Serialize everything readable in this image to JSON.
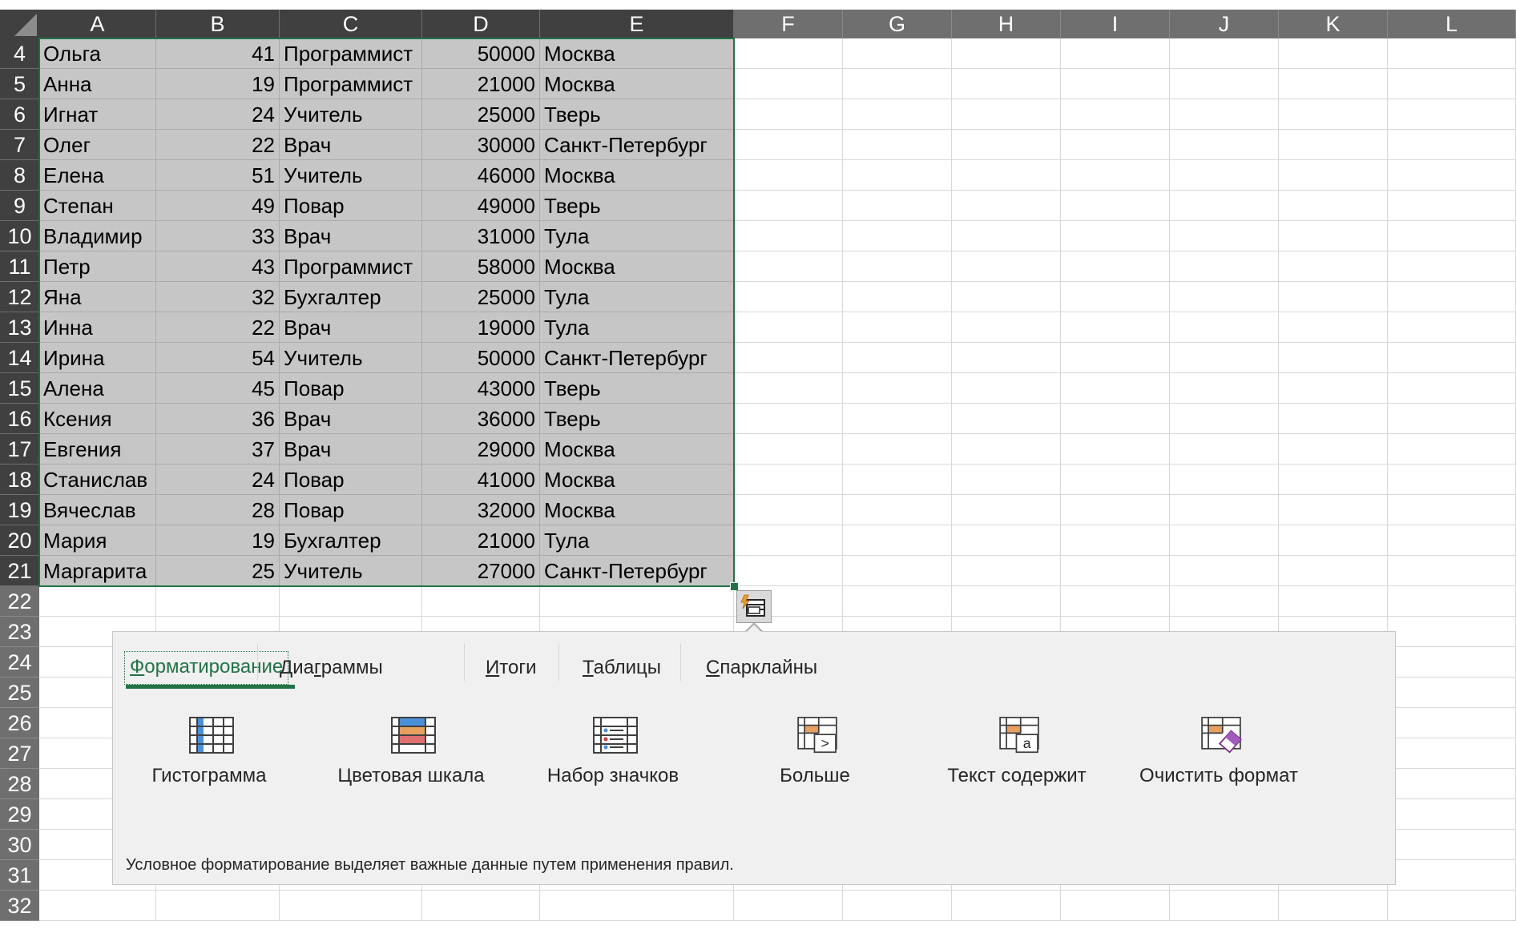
{
  "columns": [
    "A",
    "B",
    "C",
    "D",
    "E",
    "F",
    "G",
    "H",
    "I",
    "J",
    "K",
    "L"
  ],
  "rows": [
    {
      "num": "4",
      "name": "Ольга",
      "age": "41",
      "job": "Программист",
      "salary": "50000",
      "city": "Москва"
    },
    {
      "num": "5",
      "name": "Анна",
      "age": "19",
      "job": "Программист",
      "salary": "21000",
      "city": "Москва"
    },
    {
      "num": "6",
      "name": "Игнат",
      "age": "24",
      "job": "Учитель",
      "salary": "25000",
      "city": "Тверь"
    },
    {
      "num": "7",
      "name": "Олег",
      "age": "22",
      "job": "Врач",
      "salary": "30000",
      "city": "Санкт-Петербург"
    },
    {
      "num": "8",
      "name": "Елена",
      "age": "51",
      "job": "Учитель",
      "salary": "46000",
      "city": "Москва"
    },
    {
      "num": "9",
      "name": "Степан",
      "age": "49",
      "job": "Повар",
      "salary": "49000",
      "city": "Тверь"
    },
    {
      "num": "10",
      "name": "Владимир",
      "age": "33",
      "job": "Врач",
      "salary": "31000",
      "city": "Тула"
    },
    {
      "num": "11",
      "name": "Петр",
      "age": "43",
      "job": "Программист",
      "salary": "58000",
      "city": "Москва"
    },
    {
      "num": "12",
      "name": "Яна",
      "age": "32",
      "job": "Бухгалтер",
      "salary": "25000",
      "city": "Тула"
    },
    {
      "num": "13",
      "name": "Инна",
      "age": "22",
      "job": "Врач",
      "salary": "19000",
      "city": "Тула"
    },
    {
      "num": "14",
      "name": "Ирина",
      "age": "54",
      "job": "Учитель",
      "salary": "50000",
      "city": "Санкт-Петербург"
    },
    {
      "num": "15",
      "name": "Алена",
      "age": "45",
      "job": "Повар",
      "salary": "43000",
      "city": "Тверь"
    },
    {
      "num": "16",
      "name": "Ксения",
      "age": "36",
      "job": "Врач",
      "salary": "36000",
      "city": "Тверь"
    },
    {
      "num": "17",
      "name": "Евгения",
      "age": "37",
      "job": "Врач",
      "salary": "29000",
      "city": "Москва"
    },
    {
      "num": "18",
      "name": "Станислав",
      "age": "24",
      "job": "Повар",
      "salary": "41000",
      "city": "Москва"
    },
    {
      "num": "19",
      "name": "Вячеслав",
      "age": "28",
      "job": "Повар",
      "salary": "32000",
      "city": "Москва"
    },
    {
      "num": "20",
      "name": "Мария",
      "age": "19",
      "job": "Бухгалтер",
      "salary": "21000",
      "city": "Тула"
    },
    {
      "num": "21",
      "name": "Маргарита",
      "age": "25",
      "job": "Учитель",
      "salary": "27000",
      "city": "Санкт-Петербург"
    }
  ],
  "empty_rows": [
    "22",
    "23",
    "24",
    "25",
    "26",
    "27",
    "28",
    "29",
    "30",
    "31",
    "32"
  ],
  "quick_analysis": {
    "tabs": [
      {
        "label": "Форматирование",
        "key": "Ф",
        "rest": "орматирование",
        "active": true
      },
      {
        "label": "Диаграммы",
        "pre": "Диа",
        "key": "г",
        "rest": "раммы",
        "active": false
      },
      {
        "label": "Итоги",
        "key": "И",
        "rest": "тоги",
        "active": false
      },
      {
        "label": "Таблицы",
        "key": "Т",
        "rest": "аблицы",
        "active": false
      },
      {
        "label": "Спарклайны",
        "key": "С",
        "rest": "парклайны",
        "active": false
      }
    ],
    "tools": [
      {
        "label": "Гистограмма",
        "icon": "data-bars-icon"
      },
      {
        "label": "Цветовая шкала",
        "icon": "color-scale-icon"
      },
      {
        "label": "Набор значков",
        "icon": "icon-set-icon"
      },
      {
        "label": "Больше",
        "icon": "greater-than-icon"
      },
      {
        "label": "Текст содержит",
        "icon": "text-contains-icon"
      },
      {
        "label": "Очистить формат",
        "icon": "clear-format-icon"
      }
    ],
    "description": "Условное форматирование выделяет важные данные путем применения правил."
  },
  "colors": {
    "accent": "#217346",
    "header_selected": "#404040",
    "header": "#6f6f6f",
    "selection": "#c6c6c6",
    "panel": "#f0f0f0"
  }
}
